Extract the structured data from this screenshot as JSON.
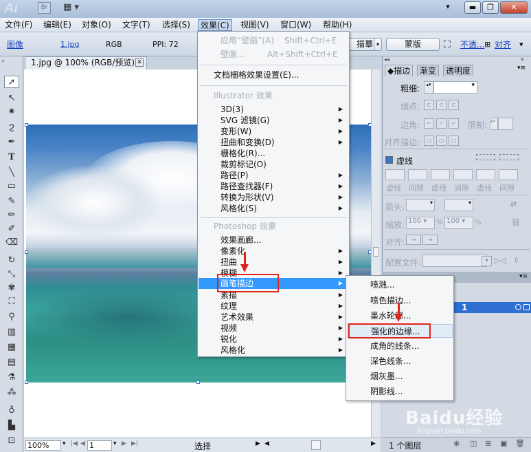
{
  "app": {
    "logo": "Ai",
    "bridge": "Br"
  },
  "menubar": [
    "文件(F)",
    "编辑(E)",
    "对象(O)",
    "文字(T)",
    "选择(S)",
    "效果(C)",
    "视图(V)",
    "窗口(W)",
    "帮助(H)"
  ],
  "controlbar": {
    "kind": "图像",
    "filename": "1.jpg",
    "mode": "RGB",
    "ppi": "PPI: 72",
    "trace_label": "描摹",
    "mask_button": "蒙版",
    "opacity_link": "不透...",
    "align_link": "对齐"
  },
  "document": {
    "tab_title": "1.jpg @ 100% (RGB/预览)"
  },
  "statusbar": {
    "zoom": "100%",
    "page": "1",
    "status": "选择"
  },
  "effects_menu": {
    "apply_last": {
      "label": "应用“壁画”(A)",
      "shortcut": "Shift+Ctrl+E"
    },
    "last_effect": {
      "label": "壁画...",
      "shortcut": "Alt+Shift+Ctrl+E"
    },
    "raster_settings": "文档栅格效果设置(E)...",
    "illustrator_header": "Illustrator 效果",
    "illustrator_items": [
      "3D(3)",
      "SVG 滤镜(G)",
      "变形(W)",
      "扭曲和变换(D)",
      "栅格化(R)...",
      "裁剪标记(O)",
      "路径(P)",
      "路径查找器(F)",
      "转换为形状(V)",
      "风格化(S)"
    ],
    "photoshop_header": "Photoshop 效果",
    "photoshop_items": [
      "效果画廊...",
      "像素化",
      "扭曲",
      "模糊",
      "画笔描边",
      "素描",
      "纹理",
      "艺术效果",
      "视频",
      "锐化",
      "风格化"
    ]
  },
  "brush_submenu": [
    "喷溅...",
    "喷色描边...",
    "墨水轮廓...",
    "强化的边缘...",
    "成角的线条...",
    "深色线条...",
    "烟灰墨...",
    "阴影线..."
  ],
  "stroke_panel": {
    "tabs": [
      "描边",
      "渐变",
      "透明度"
    ],
    "weight": "粗细:",
    "cap": "端点:",
    "corner": "边角:",
    "limit": "限制:",
    "align": "对齐描边:",
    "dashed": "虚线",
    "dash_labels": [
      "虚线",
      "间隙",
      "虚线",
      "间隙",
      "虚线",
      "间隙"
    ],
    "arrowheads": "箭头:",
    "scale": "缩放:",
    "scale_val1": "100",
    "scale_val2": "100",
    "percent": "%",
    "align2": "对齐:",
    "profile": "配置文件:"
  },
  "layers_panel": {
    "layer_number": "1",
    "count": "1 个图层"
  },
  "watermark": {
    "brand": "Baidu经验",
    "url": "jingyan.baidu.com"
  },
  "colors": {
    "highlight": "#3399ff",
    "annotation_red": "#e0251c"
  }
}
